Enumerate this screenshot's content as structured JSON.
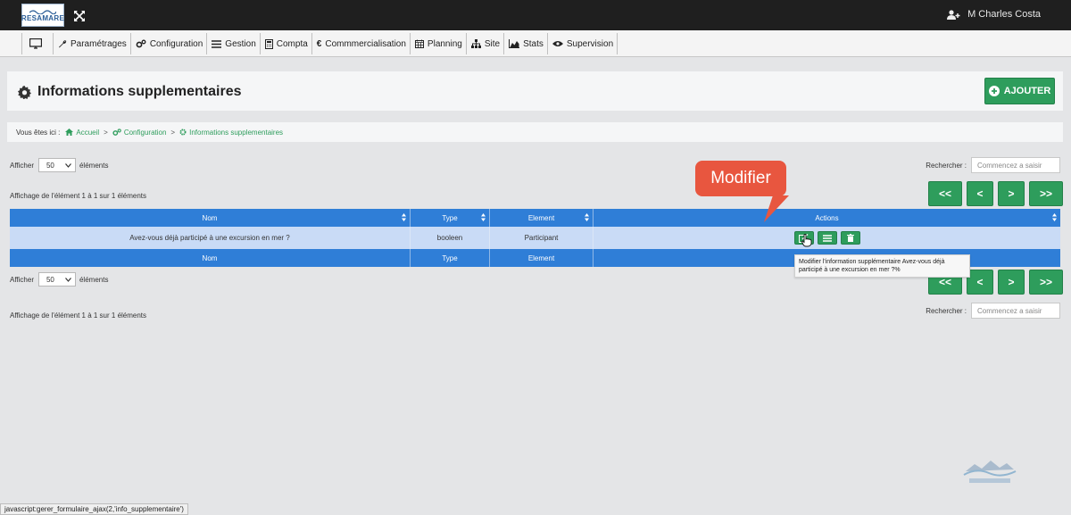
{
  "header": {
    "logo_text": "RESAMARE",
    "user_name": "M Charles Costa"
  },
  "menu": {
    "items": [
      {
        "label": "Paramétrages"
      },
      {
        "label": "Configuration"
      },
      {
        "label": "Gestion"
      },
      {
        "label": "Compta"
      },
      {
        "label": "Commmercialisation"
      },
      {
        "label": "Planning"
      },
      {
        "label": "Site"
      },
      {
        "label": "Stats"
      },
      {
        "label": "Supervision"
      }
    ]
  },
  "page": {
    "title": "Informations supplementaires",
    "add_label": "AJOUTER"
  },
  "breadcrumb": {
    "prefix": "Vous êtes ici :",
    "items": [
      "Accueil",
      "Configuration",
      "Informations supplementaires"
    ],
    "separator": ">"
  },
  "controls": {
    "show_label": "Afficher",
    "page_size": "50",
    "elements_label": "éléments",
    "info": "Affichage de l'élément 1 à 1 sur 1 éléments",
    "search_label": "Rechercher :",
    "search_placeholder": "Commencez a saisir"
  },
  "table": {
    "columns": [
      "Nom",
      "Type",
      "Element",
      "Actions"
    ],
    "footer": [
      "Nom",
      "Type",
      "Element",
      ""
    ],
    "rows": [
      {
        "nom": "Avez-vous déjà participé à une excursion en mer ?",
        "type": "booleen",
        "element": "Participant"
      }
    ]
  },
  "pager": {
    "first": "<<",
    "prev": "<",
    "next": ">",
    "last": ">>"
  },
  "annotation": {
    "callout": "Modifier",
    "tooltip": "Modifier l'information supplémentaire Avez-vous déjà participé à une excursion en mer ?%"
  },
  "status_bar": {
    "url": "javascript:gerer_formulaire_ajax(2,'info_supplementaire')"
  },
  "colors": {
    "accent_green": "#2e9d5c",
    "table_header_blue": "#2f7ed7",
    "row_highlight": "#c9dbf6",
    "callout_red": "#e8563f"
  },
  "icons": [
    "expand-icon",
    "add-user-icon",
    "monitor-icon",
    "wrench-icon",
    "cogs-icon",
    "list-icon",
    "calculator-icon",
    "euro-icon",
    "calendar-icon",
    "sitemap-icon",
    "area-chart-icon",
    "eye-icon",
    "gear-icon",
    "plus-circle-icon",
    "home-icon",
    "edit-icon",
    "list-icon",
    "trash-icon",
    "sort-icon",
    "pointer-cursor-icon"
  ]
}
